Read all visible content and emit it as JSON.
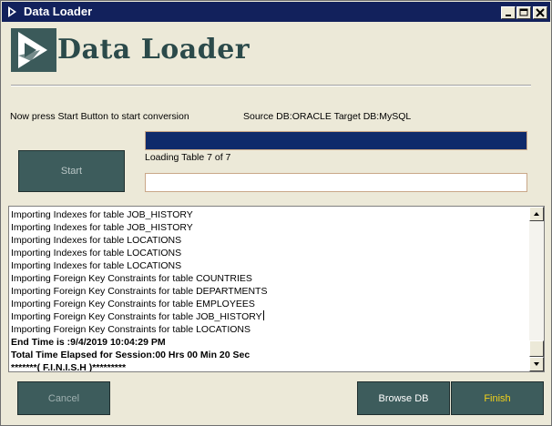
{
  "window": {
    "title": "Data Loader",
    "logo_text": "Data Loader"
  },
  "titlebar_buttons": {
    "minimize": "_",
    "maximize": "□",
    "close": "×"
  },
  "status": {
    "instruction": "Now press Start Button to start conversion",
    "source_target": "Source DB:ORACLE Target DB:MySQL",
    "loading": "Loading Table 7 of 7",
    "progress_fraction": 1.0,
    "secondary_progress_fraction": 0.0
  },
  "buttons": {
    "start": "Start",
    "cancel": "Cancel",
    "browse": "Browse DB",
    "finish": "Finish"
  },
  "log": [
    {
      "text": "Importing Indexes for table JOB_HISTORY",
      "bold": false
    },
    {
      "text": "Importing Indexes for table JOB_HISTORY",
      "bold": false
    },
    {
      "text": "Importing Indexes for table LOCATIONS",
      "bold": false
    },
    {
      "text": "Importing Indexes for table LOCATIONS",
      "bold": false
    },
    {
      "text": "Importing Indexes for table LOCATIONS",
      "bold": false
    },
    {
      "text": "Importing Foreign Key Constraints for table COUNTRIES",
      "bold": false
    },
    {
      "text": "Importing Foreign Key Constraints for table DEPARTMENTS",
      "bold": false
    },
    {
      "text": "Importing Foreign Key Constraints for table EMPLOYEES",
      "bold": false
    },
    {
      "text": "Importing Foreign Key Constraints for table JOB_HISTORY",
      "bold": false,
      "caret": true
    },
    {
      "text": "Importing Foreign Key Constraints for table LOCATIONS",
      "bold": false
    },
    {
      "text": "End Time is :9/4/2019 10:04:29 PM",
      "bold": true
    },
    {
      "text": "Total Time Elapsed for Session:00 Hrs 00 Min 20 Sec",
      "bold": true
    },
    {
      "text": "*******( F.I.N.I.S.H )*********",
      "bold": true
    }
  ],
  "colors": {
    "title_bar": "#12215c",
    "progress": "#0f2a6b",
    "button_bg": "#3d5c5c",
    "finish_text": "#f2d21a"
  }
}
